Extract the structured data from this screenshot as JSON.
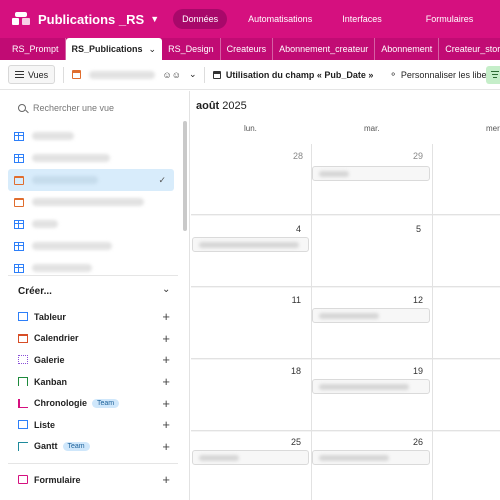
{
  "app": {
    "base_title": "Publications _RS",
    "nav": [
      "Données",
      "Automatisations",
      "Interfaces",
      "Formulaires"
    ],
    "active_nav": "Données",
    "brand_color": "#d5107f"
  },
  "tabs": [
    "RS_Prompt",
    "RS_Publications",
    "RS_Design",
    "Createurs",
    "Abonnement_createur",
    "Abonnement",
    "Createur_story"
  ],
  "active_tab": "RS_Publications",
  "toolbar": {
    "views_label": "Vues",
    "field_usage_label": "Utilisation du champ « Pub_Date »",
    "customize_labels": "Personnaliser les libellés"
  },
  "sidebar": {
    "search_placeholder": "Rechercher une vue",
    "views": [
      {
        "icon": "grid-icon"
      },
      {
        "icon": "grid-icon"
      },
      {
        "icon": "calendar-icon",
        "selected": true
      },
      {
        "icon": "calendar-icon"
      },
      {
        "icon": "grid-icon"
      },
      {
        "icon": "grid-icon"
      },
      {
        "icon": "grid-icon"
      }
    ],
    "create_heading": "Créer...",
    "create_items": [
      {
        "label": "Tableur",
        "icon": "table-icon"
      },
      {
        "label": "Calendrier",
        "icon": "calendar-icon"
      },
      {
        "label": "Galerie",
        "icon": "gallery-icon"
      },
      {
        "label": "Kanban",
        "icon": "kanban-icon"
      },
      {
        "label": "Chronologie",
        "icon": "timeline-icon",
        "badge": "Team"
      },
      {
        "label": "Liste",
        "icon": "list-icon"
      },
      {
        "label": "Gantt",
        "icon": "gantt-icon",
        "badge": "Team"
      }
    ],
    "form_item": {
      "label": "Formulaire",
      "icon": "form-icon"
    }
  },
  "calendar": {
    "month": "août",
    "year": "2025",
    "day_headers": [
      "lun.",
      "mar.",
      "mer."
    ],
    "weeks": [
      {
        "days": [
          "28",
          "29",
          ""
        ]
      },
      {
        "days": [
          "4",
          "5",
          ""
        ]
      },
      {
        "days": [
          "11",
          "12",
          ""
        ]
      },
      {
        "days": [
          "18",
          "19",
          ""
        ]
      },
      {
        "days": [
          "25",
          "26",
          ""
        ]
      }
    ]
  }
}
